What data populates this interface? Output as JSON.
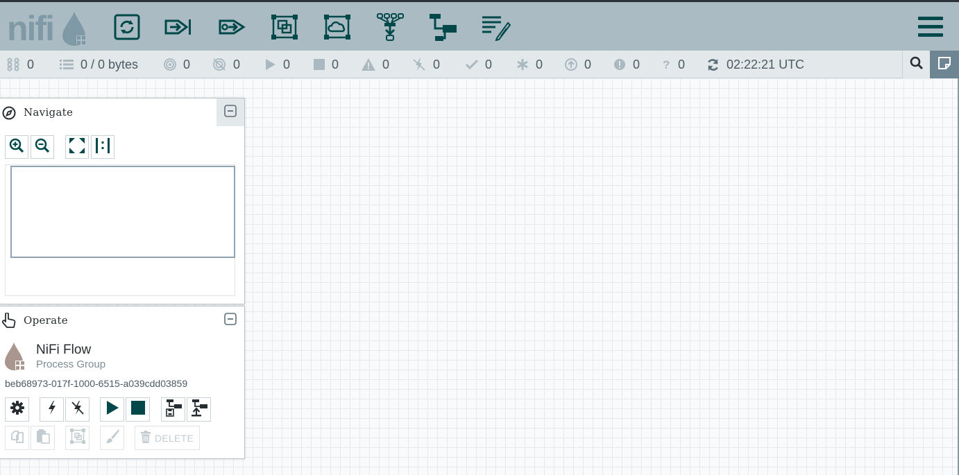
{
  "header": {
    "logo_text": "nifi",
    "toolbar": [
      {
        "name": "processor-tool",
        "icon": "processor-icon"
      },
      {
        "name": "input-port-tool",
        "icon": "input-port-icon"
      },
      {
        "name": "output-port-tool",
        "icon": "output-port-icon"
      },
      {
        "name": "process-group-tool",
        "icon": "process-group-icon"
      },
      {
        "name": "remote-process-group-tool",
        "icon": "remote-process-group-icon"
      },
      {
        "name": "funnel-tool",
        "icon": "funnel-icon"
      },
      {
        "name": "template-tool",
        "icon": "template-icon"
      },
      {
        "name": "label-tool",
        "icon": "label-icon"
      }
    ],
    "menu_icon": "hamburger-menu-icon"
  },
  "status": {
    "active_threads": "0",
    "queued": "0 / 0 bytes",
    "transmitting": "0",
    "not_transmitting": "0",
    "running": "0",
    "stopped": "0",
    "invalid": "0",
    "disabled": "0",
    "up_to_date": "0",
    "locally_modified": "0",
    "stale": "0",
    "locally_modified_stale": "0",
    "sync_failure": "0",
    "last_refreshed": "02:22:21 UTC"
  },
  "navigate": {
    "title": "Navigate"
  },
  "operate": {
    "title": "Operate",
    "group_name": "NiFi Flow",
    "group_type": "Process Group",
    "group_id": "beb68973-017f-1000-6515-a039cdd03859",
    "delete_label": "DELETE"
  },
  "colors": {
    "header_bg": "#aabbc3",
    "icon_dark": "#004849",
    "status_bg": "#e3e8eb",
    "bulletin_bg": "#6e8694"
  }
}
